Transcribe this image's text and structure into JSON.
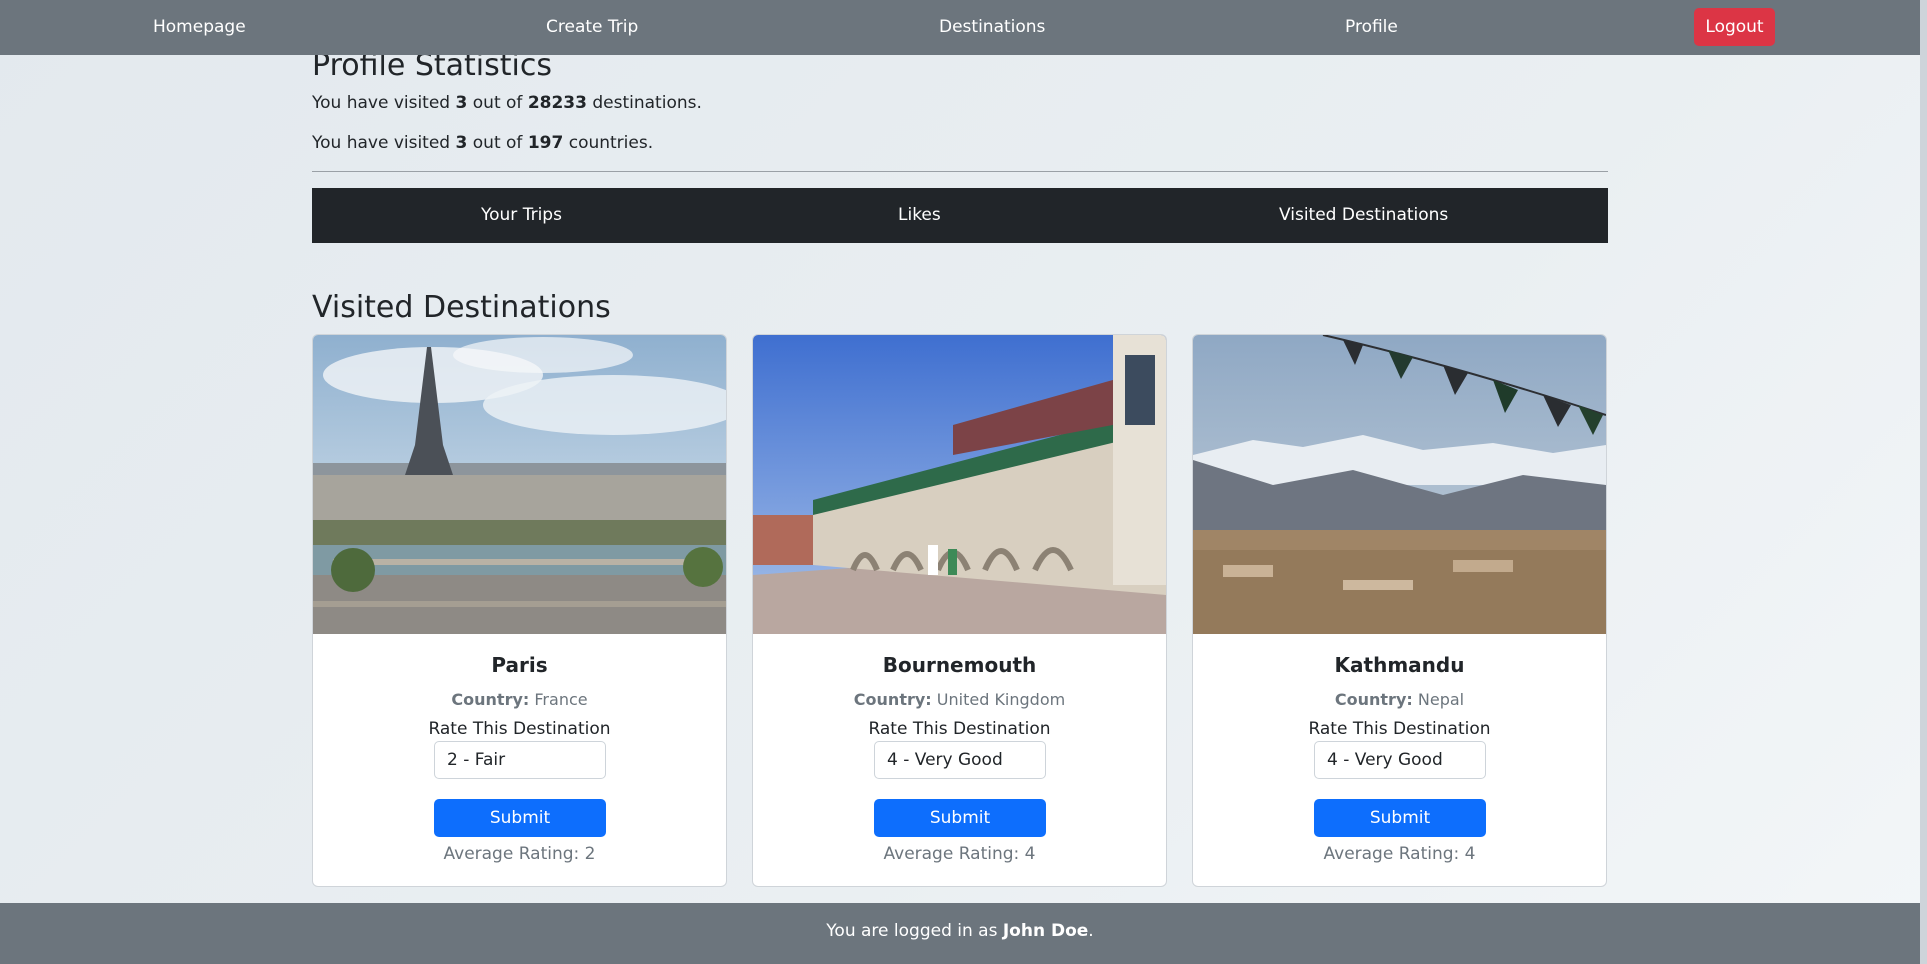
{
  "nav": {
    "homepage": "Homepage",
    "create_trip": "Create Trip",
    "destinations": "Destinations",
    "profile": "Profile",
    "logout": "Logout"
  },
  "stats": {
    "title": "Profile Statistics",
    "line1": {
      "prefix": "You have visited ",
      "visited": "3",
      "mid": " out of ",
      "total": "28233",
      "suffix": " destinations."
    },
    "line2": {
      "prefix": "You have visited ",
      "visited": "3",
      "mid": " out of ",
      "total": "197",
      "suffix": " countries."
    }
  },
  "tabs": {
    "your_trips": "Your Trips",
    "likes": "Likes",
    "visited": "Visited Destinations"
  },
  "section": {
    "title": "Visited Destinations"
  },
  "cards": [
    {
      "name": "Paris",
      "country_label": "Country:",
      "country": "France",
      "rate_label": "Rate This Destination",
      "rating": "2 - Fair",
      "submit": "Submit",
      "avg": "Average Rating: 2"
    },
    {
      "name": "Bournemouth",
      "country_label": "Country:",
      "country": "United Kingdom",
      "rate_label": "Rate This Destination",
      "rating": "4 - Very Good",
      "submit": "Submit",
      "avg": "Average Rating: 4"
    },
    {
      "name": "Kathmandu",
      "country_label": "Country:",
      "country": "Nepal",
      "rate_label": "Rate This Destination",
      "rating": "4 - Very Good",
      "submit": "Submit",
      "avg": "Average Rating: 4"
    }
  ],
  "footer": {
    "prefix": "You are logged in as ",
    "user": "John Doe",
    "suffix": "."
  },
  "colors": {
    "nav_bg": "#6c757d",
    "tab_bg": "#212529",
    "primary": "#0d6efd",
    "danger": "#dc3545"
  }
}
